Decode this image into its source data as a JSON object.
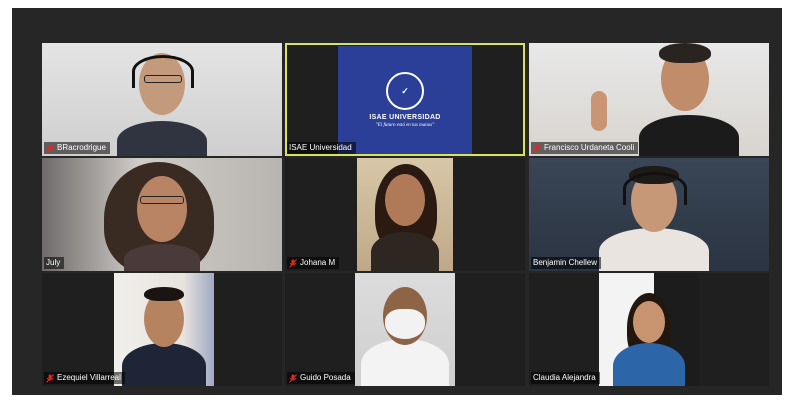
{
  "meeting": {
    "participants": [
      {
        "name": "BRacrodrigue",
        "muted": true
      },
      {
        "name": "ISAE Universidad",
        "muted": false,
        "active_speaker": true
      },
      {
        "name": "Francisco Urdaneta Cooli",
        "muted": true
      },
      {
        "name": "July",
        "muted": false
      },
      {
        "name": "Johana M",
        "muted": true
      },
      {
        "name": "Benjamin Chellew",
        "muted": false
      },
      {
        "name": "Ezequiel Villarreal",
        "muted": true
      },
      {
        "name": "Guido Posada",
        "muted": true
      },
      {
        "name": "Claudia Alejandra",
        "muted": false
      }
    ]
  },
  "logo": {
    "arc_text": "ISAE UNIVERSIDAD",
    "name": "ISAE UNIVERSIDAD",
    "tagline": "\"El futuro está en tus manos\""
  },
  "colors": {
    "background": "#262626",
    "active_border": "#d9e35a",
    "muted_icon": "#e02828",
    "logo_blue": "#2b3f98"
  },
  "icons": {
    "muted": "microphone-muted-icon"
  }
}
